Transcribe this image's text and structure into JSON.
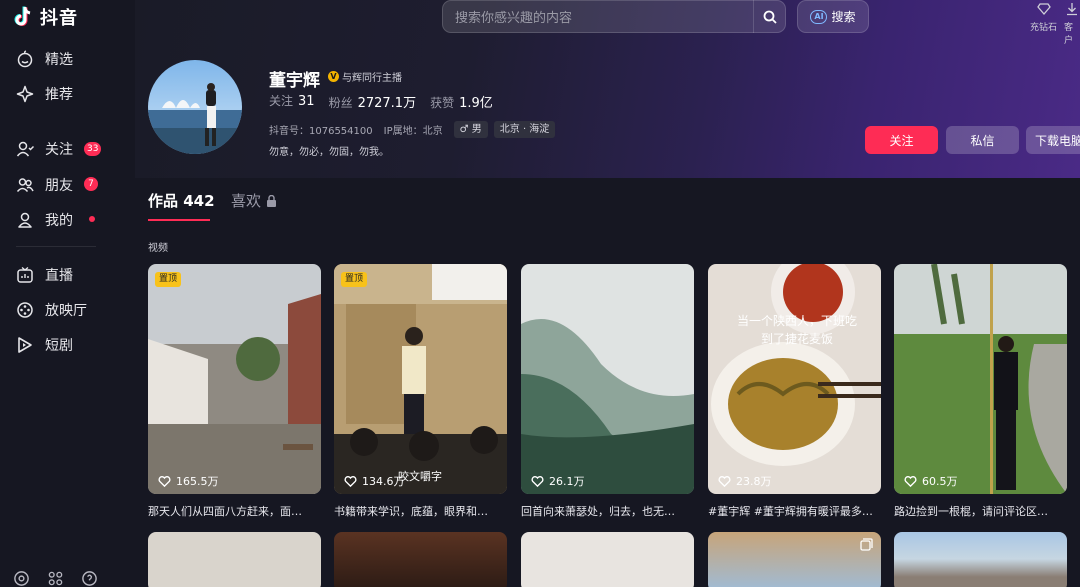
{
  "app": {
    "name": "抖音"
  },
  "sidebar": {
    "items": [
      {
        "label": "精选"
      },
      {
        "label": "推荐"
      },
      {
        "label": "关注",
        "badge": "33"
      },
      {
        "label": "朋友",
        "badge": "7"
      },
      {
        "label": "我的"
      },
      {
        "label": "直播"
      },
      {
        "label": "放映厅"
      },
      {
        "label": "短剧"
      }
    ]
  },
  "header": {
    "search_placeholder": "搜索你感兴趣的内容",
    "ai_search_label": "搜索",
    "ai_chip": "AI",
    "tools": [
      {
        "label": "充钻石"
      },
      {
        "label": "客户"
      }
    ]
  },
  "profile": {
    "name": "董宇辉",
    "verified_label": "与辉同行主播",
    "verified_mark": "V",
    "following_label": "关注",
    "following_value": "31",
    "followers_label": "粉丝",
    "followers_value": "2727.1万",
    "likes_label": "获赞",
    "likes_value": "1.9亿",
    "douyin_id": "抖音号：1076554100",
    "ip_location": "IP属地：北京",
    "gender_tag": "♂ 男",
    "region_tag": "北京 · 海淀",
    "bio": "勿意，勿必，勿固，勿我。",
    "follow_button": "关注",
    "message_button": "私信",
    "download_button": "下载电脑"
  },
  "tabs": {
    "works_label": "作品 442",
    "likes_label": "喜欢"
  },
  "section_label": "视频",
  "videos": [
    {
      "pinned": "置顶",
      "likes": "165.5万",
      "caption": "那天人们从四面八方赶来，面…"
    },
    {
      "pinned": "置顶",
      "likes": "134.6万",
      "caption": "书籍带来学识，底蕴，眼界和…",
      "overlay": "咬文嚼字"
    },
    {
      "likes": "26.1万",
      "caption": "回首向来萧瑟处，归去，也无…"
    },
    {
      "likes": "23.8万",
      "caption": "#董宇辉 #董宇辉拥有暖评最多…",
      "overlay": "当一个陕西人，下班吃到了捷花麦饭"
    },
    {
      "likes": "60.5万",
      "caption": "路边捡到一根棍，请问评论区…"
    }
  ],
  "colors": {
    "accent": "#fe2c55",
    "background": "#161722",
    "pin_tag": "#f8c21a"
  }
}
